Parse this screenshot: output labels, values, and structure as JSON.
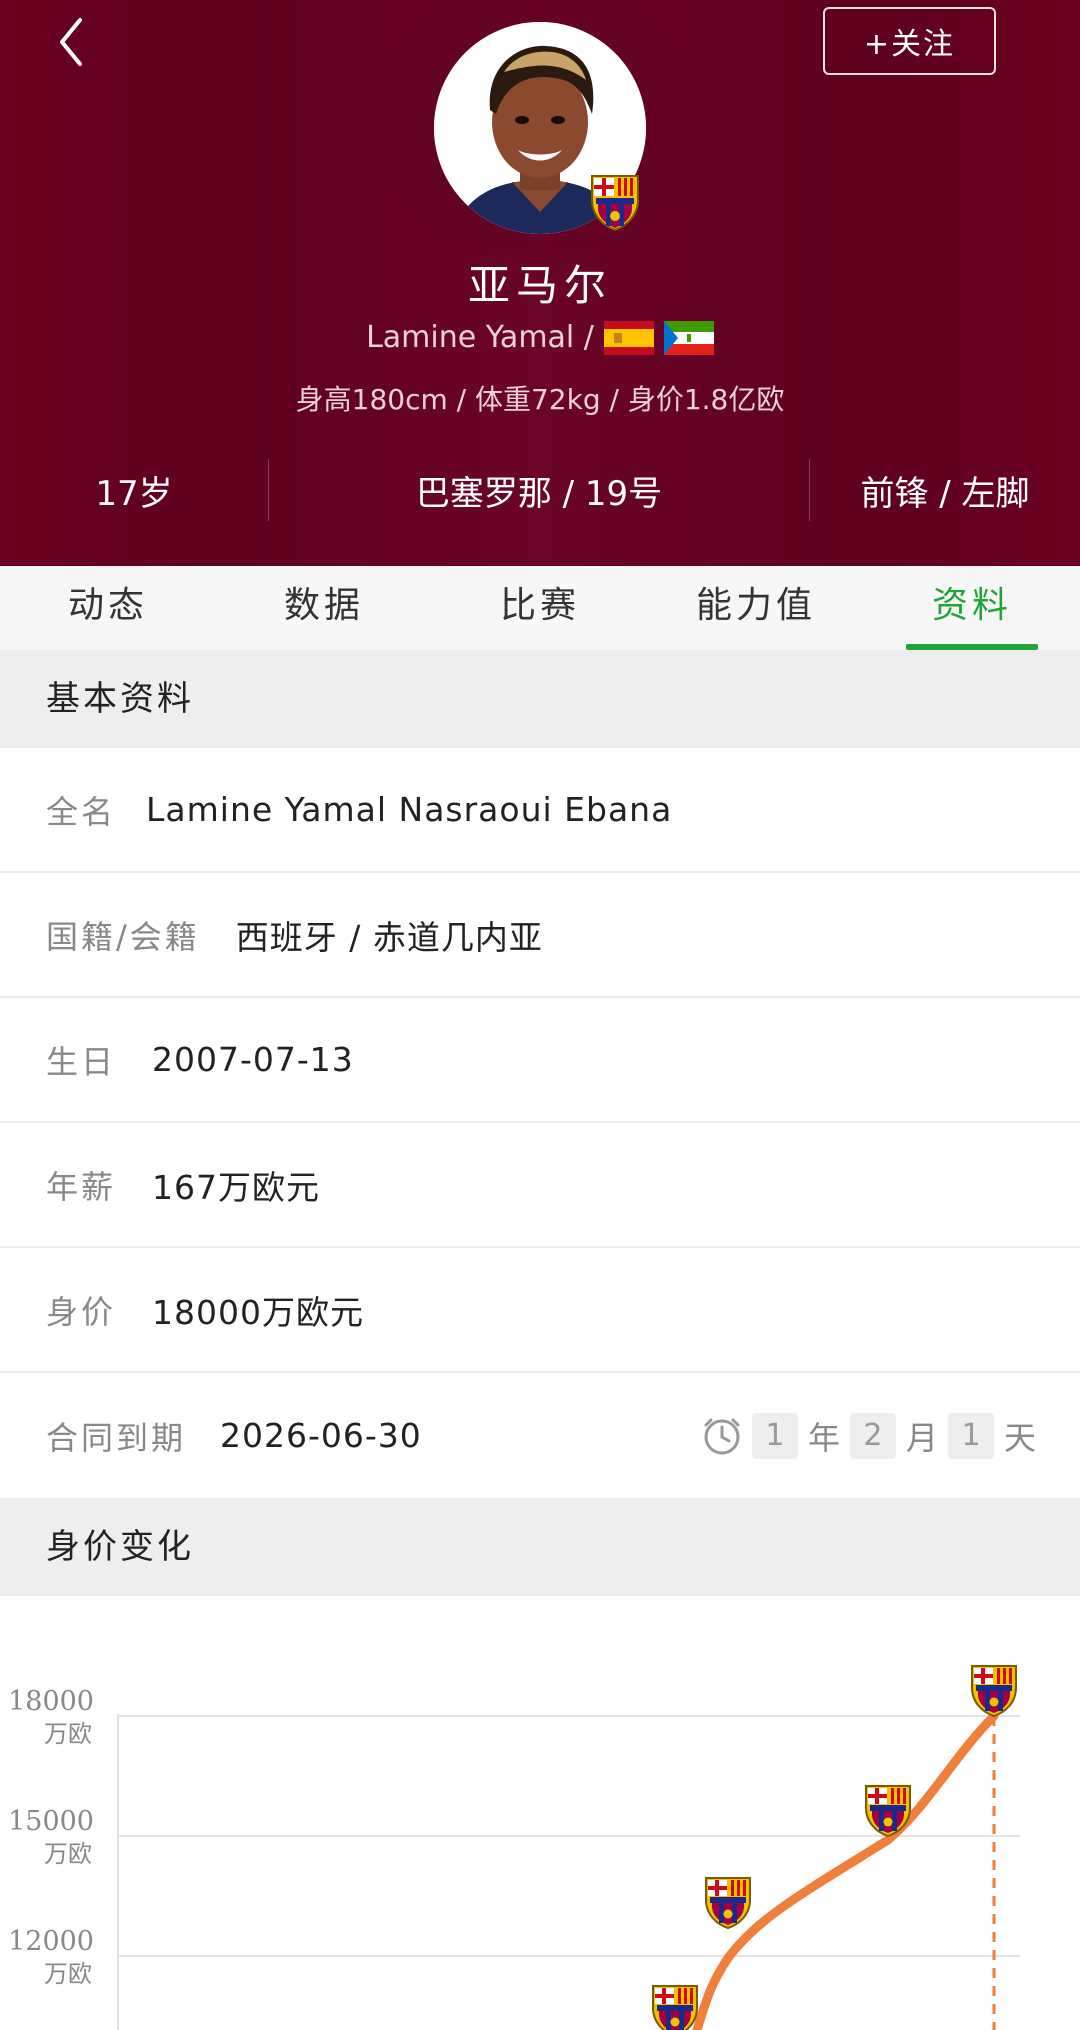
{
  "header": {
    "follow_label": "+关注",
    "name_cn": "亚马尔",
    "name_en": "Lamine Yamal /",
    "stats_line": "身高180cm / 体重72kg / 身价1.8亿欧",
    "age": "17岁",
    "club_number": "巴塞罗那 / 19号",
    "position_foot": "前锋 / 左脚"
  },
  "tabs": [
    {
      "label": "动态",
      "active": false
    },
    {
      "label": "数据",
      "active": false
    },
    {
      "label": "比赛",
      "active": false
    },
    {
      "label": "能力值",
      "active": false
    },
    {
      "label": "资料",
      "active": true
    }
  ],
  "basic_info": {
    "title": "基本资料",
    "rows": [
      {
        "label": "全名",
        "value": "Lamine Yamal Nasraoui Ebana"
      },
      {
        "label": "国籍/会籍",
        "value": "西班牙 / 赤道几内亚"
      },
      {
        "label": "生日",
        "value": "2007-07-13"
      },
      {
        "label": "年薪",
        "value": "167万欧元"
      },
      {
        "label": "身价",
        "value": "18000万欧元"
      }
    ],
    "contract": {
      "label": "合同到期",
      "value": "2026-06-30",
      "countdown": {
        "years": "1",
        "year_unit": "年",
        "months": "2",
        "month_unit": "月",
        "days": "1",
        "day_unit": "天"
      }
    }
  },
  "value_change": {
    "title": "身价变化"
  },
  "chart_data": {
    "type": "line",
    "yticks": [
      {
        "value": 18000,
        "label": "18000",
        "unit": "万欧"
      },
      {
        "value": 15000,
        "label": "15000",
        "unit": "万欧"
      },
      {
        "value": 12000,
        "label": "12000",
        "unit": "万欧"
      }
    ],
    "series": [
      {
        "values": [
          11000,
          12700,
          15000,
          18000
        ]
      }
    ],
    "line_color": "#f07f3c",
    "marker": "fcb-badge-icon"
  },
  "colors": {
    "header_bg": "#6a0022",
    "accent_green": "#22a43a",
    "line_orange": "#f07f3c"
  }
}
